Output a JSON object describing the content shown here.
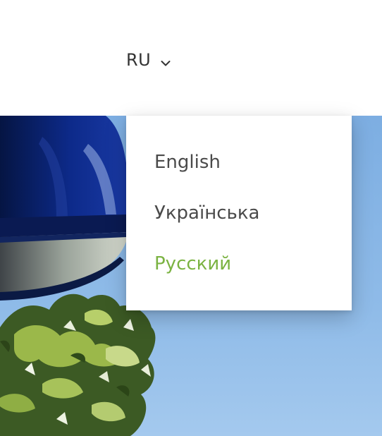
{
  "header": {
    "current_language": "RU",
    "chevron_icon": "chevron-down-icon"
  },
  "language_menu": {
    "items": [
      {
        "label": "English",
        "active": false
      },
      {
        "label": "Українська",
        "active": false
      },
      {
        "label": "Русский",
        "active": true
      }
    ]
  },
  "colors": {
    "active_item": "#7bb342",
    "text": "#4a4a4a",
    "sky": "#8bb8e6",
    "lamp_shade": "#0b1f6b"
  }
}
